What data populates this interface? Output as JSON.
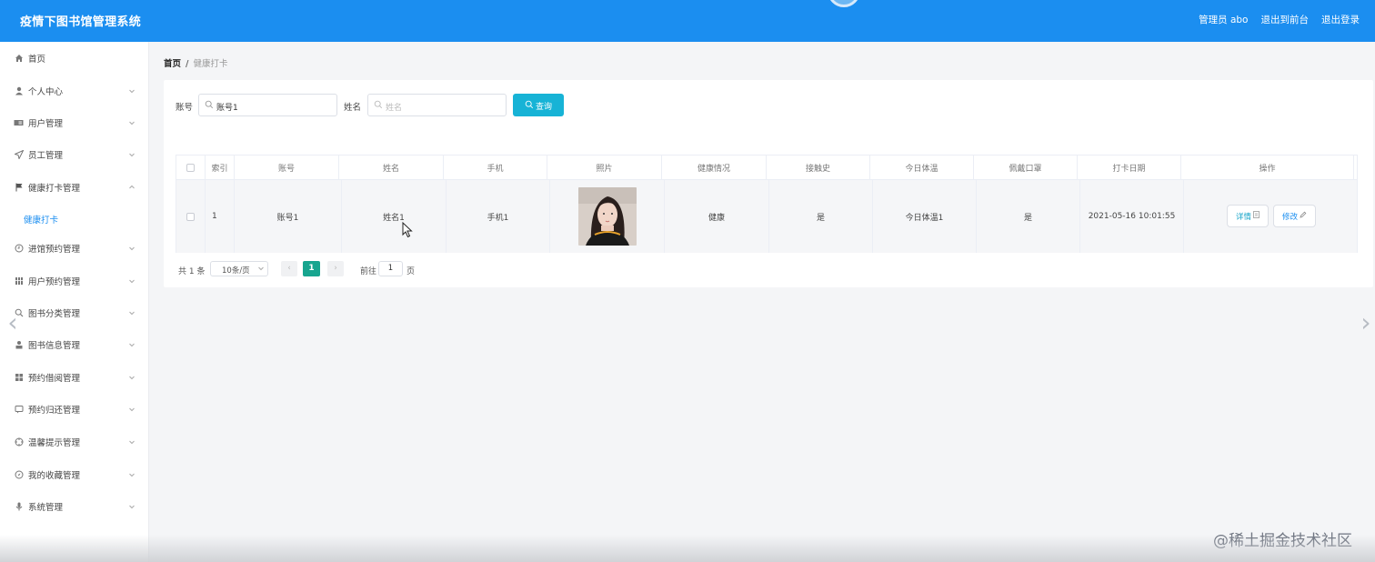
{
  "header": {
    "title": "疫情下图书馆管理系统",
    "user_label": "管理员 abo",
    "front_link": "退出到前台",
    "logout": "退出登录"
  },
  "sidebar": {
    "items": [
      {
        "label": "首页",
        "icon": "home-icon"
      },
      {
        "label": "个人中心",
        "icon": "user-icon"
      },
      {
        "label": "用户管理",
        "icon": "id-card-icon"
      },
      {
        "label": "员工管理",
        "icon": "send-icon"
      },
      {
        "label": "健康打卡管理",
        "icon": "flag-icon"
      },
      {
        "label": "进馆预约管理",
        "icon": "clock-icon"
      },
      {
        "label": "用户预约管理",
        "icon": "grid-icon"
      },
      {
        "label": "图书分类管理",
        "icon": "search-icon"
      },
      {
        "label": "图书信息管理",
        "icon": "person-icon"
      },
      {
        "label": "预约借阅管理",
        "icon": "apps-icon"
      },
      {
        "label": "预约归还管理",
        "icon": "chat-icon"
      },
      {
        "label": "温馨提示管理",
        "icon": "target-icon"
      },
      {
        "label": "我的收藏管理",
        "icon": "compass-icon"
      },
      {
        "label": "系统管理",
        "icon": "mic-icon"
      }
    ],
    "sub_item": "健康打卡"
  },
  "breadcrumb": {
    "home": "首页",
    "separator": "/",
    "current": "健康打卡"
  },
  "search": {
    "account_label": "账号",
    "account_value": "账号1",
    "name_label": "姓名",
    "name_placeholder": "姓名",
    "query_button": "查询"
  },
  "table": {
    "columns": [
      "",
      "索引",
      "账号",
      "姓名",
      "手机",
      "照片",
      "健康情况",
      "接触史",
      "今日体温",
      "佩戴口罩",
      "打卡日期",
      "操作"
    ],
    "rows": [
      {
        "index": "1",
        "account": "账号1",
        "name": "姓名1",
        "phone": "手机1",
        "health": "健康",
        "contact": "是",
        "temperature": "今日体温1",
        "mask": "是",
        "date": "2021-05-16 10:01:55",
        "detail_button": "详情",
        "edit_button": "修改"
      }
    ]
  },
  "pagination": {
    "total": "共 1 条",
    "page_size": "10条/页",
    "current_page": "1",
    "goto_label": "前往",
    "goto_value": "1",
    "page_suffix": "页"
  },
  "watermark": "@稀土掘金技术社区",
  "colors": {
    "header": "#1b8ef0",
    "query_button": "#17b3d6",
    "active_page": "#17a58f"
  }
}
